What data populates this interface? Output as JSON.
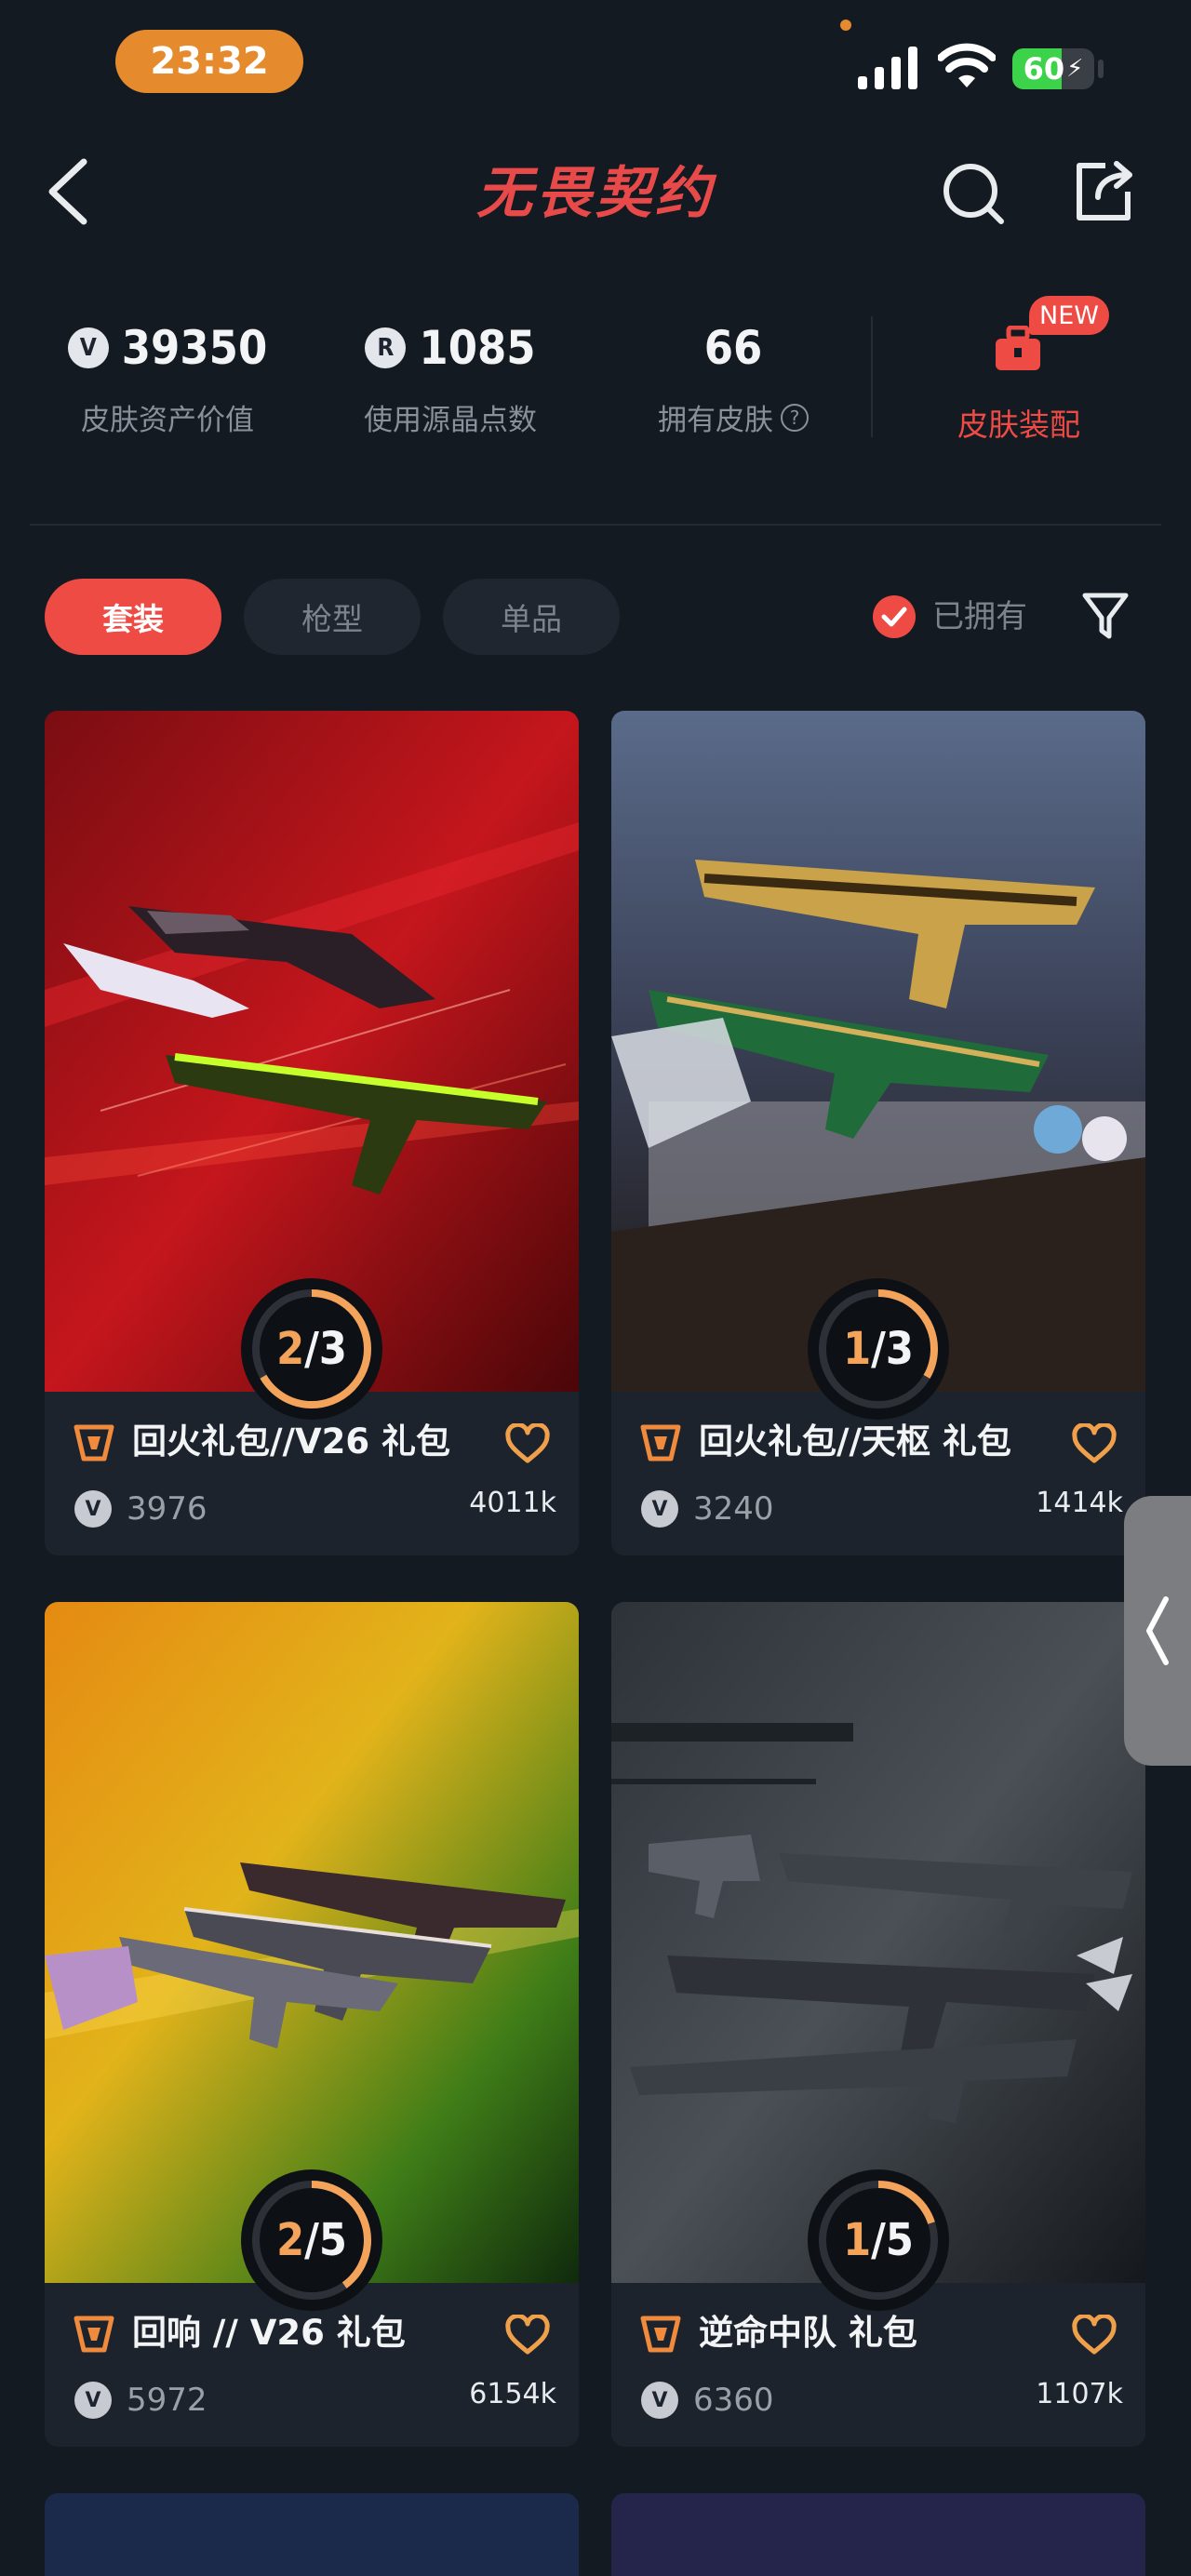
{
  "status_bar": {
    "time": "23:32",
    "battery": "60",
    "battery_level": 0.6
  },
  "header": {
    "title": "无畏契约"
  },
  "stats": [
    {
      "value": "39350",
      "label": "皮肤资产价值"
    },
    {
      "value": "1085",
      "label": "使用源晶点数"
    },
    {
      "value": "66",
      "label": "拥有皮肤"
    }
  ],
  "equip": {
    "badge": "NEW",
    "label": "皮肤装配"
  },
  "tabs": [
    "套装",
    "枪型",
    "单品"
  ],
  "owned_filter": {
    "label": "已拥有",
    "checked": true
  },
  "cards": [
    {
      "title": "回火礼包//V26 礼包",
      "owned": "2",
      "total": "3",
      "fraction": 0.667,
      "price": "3976",
      "likes": "4011k"
    },
    {
      "title": "回火礼包//天枢 礼包",
      "owned": "1",
      "total": "3",
      "fraction": 0.333,
      "price": "3240",
      "likes": "1414k"
    },
    {
      "title": "回响 // V26 礼包",
      "owned": "2",
      "total": "5",
      "fraction": 0.4,
      "price": "5972",
      "likes": "6154k"
    },
    {
      "title": "逆命中队 礼包",
      "owned": "1",
      "total": "5",
      "fraction": 0.2,
      "price": "6360",
      "likes": "1107k"
    }
  ],
  "colors": {
    "accent": "#ef4b45",
    "progress": "#f3a35a",
    "background": "#141a22",
    "card": "#1c232c"
  },
  "icons": [
    "back-icon",
    "search-icon",
    "share-icon",
    "bag-icon",
    "help-icon",
    "check-icon",
    "filter-icon",
    "tier-icon",
    "heart-icon",
    "chevron-left-icon"
  ]
}
